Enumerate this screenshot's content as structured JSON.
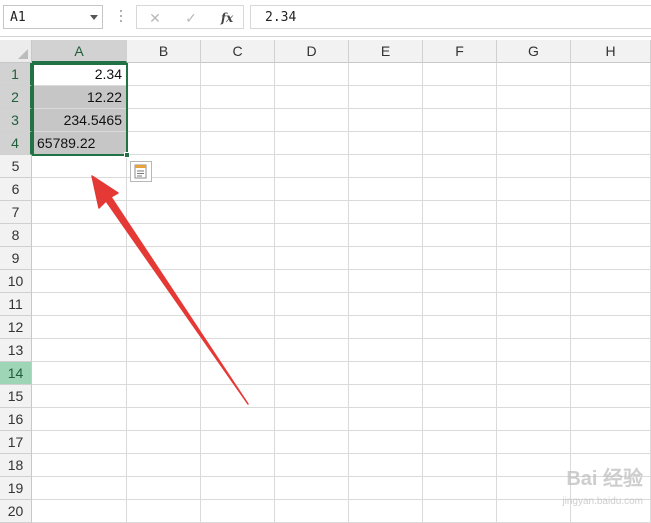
{
  "formula_bar": {
    "name_box": "A1",
    "cancel_icon": "✕",
    "enter_icon": "✓",
    "fx_label": "fx",
    "formula_value": "2.34"
  },
  "columns": [
    "A",
    "B",
    "C",
    "D",
    "E",
    "F",
    "G",
    "H"
  ],
  "rows": [
    "1",
    "2",
    "3",
    "4",
    "5",
    "6",
    "7",
    "8",
    "9",
    "10",
    "11",
    "12",
    "13",
    "14",
    "15",
    "16",
    "17",
    "18",
    "19",
    "20"
  ],
  "cells": {
    "A1": "2.34",
    "A2": "12.22",
    "A3": "234.5465",
    "A4": "65789.22"
  },
  "selection": {
    "range": "A1:A4",
    "active": "A1",
    "highlight_row": "14",
    "accent_color": "#217346",
    "selection_fill": "#c6c6c6",
    "arrow_color": "#e53935"
  },
  "icons": {
    "quick_analysis": "quick-analysis-icon",
    "name_box_dropdown": "chevron-down-icon"
  },
  "watermark": {
    "text": "Bai 经验",
    "sub": "jingyan.baidu.com"
  }
}
